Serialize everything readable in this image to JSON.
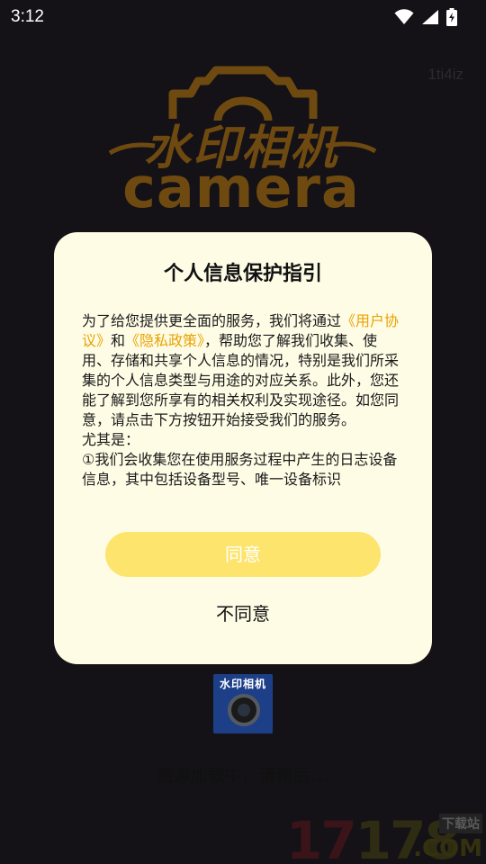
{
  "status_bar": {
    "time": "3:12",
    "icons": [
      "wifi-icon",
      "cellular-signal-icon",
      "battery-charging-icon"
    ]
  },
  "splash": {
    "watermark_id": "1ti4iz",
    "logo_cn": "水印相机",
    "logo_en": "camera",
    "app_icon_label": "水印相机",
    "loading_text": "资源加载中，请稍后..."
  },
  "site_watermark": {
    "number_part1": "17",
    "number_part2": "178",
    "tag": "下载站",
    "domain": ".COM"
  },
  "dialog": {
    "title": "个人信息保护指引",
    "body": {
      "intro": "为了给您提供更全面的服务，我们将通过",
      "link_user_agreement": "《用户协议》",
      "and": "和",
      "link_privacy_policy": "《隐私政策》",
      "after_links": "，帮助您了解我们收集、使用、存储和共享个人信息的情况，特别是我们所采集的个人信息类型与用途的对应关系。此外，您还能了解到您所享有的相关权利及实现途径。如您同意，请点击下方按钮开始接受我们的服务。",
      "especially": "尤其是：",
      "item1": "①我们会收集您在使用服务过程中产生的日志设备信息，其中包括设备型号、唯一设备标识"
    },
    "agree_label": "同意",
    "disagree_label": "不同意"
  },
  "colors": {
    "background": "#141216",
    "dialog_bg": "#fffce6",
    "link": "#e8a200",
    "agree_button": "#fde46d",
    "logo": "#6e4a10"
  }
}
